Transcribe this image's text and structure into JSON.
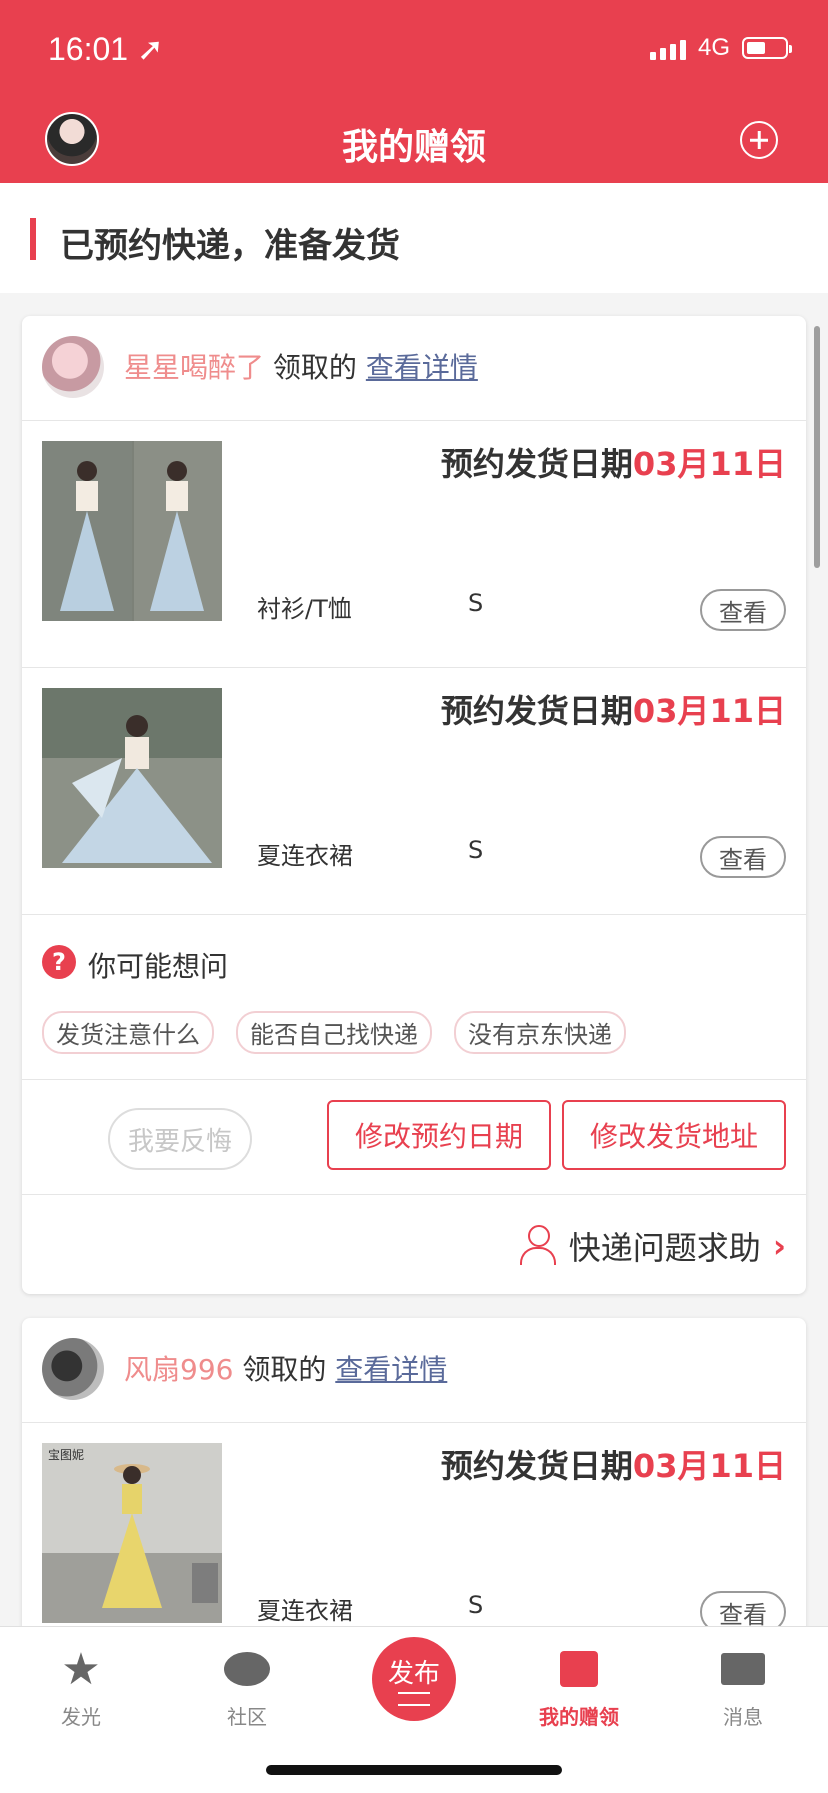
{
  "status": {
    "time": "16:01",
    "network": "4G"
  },
  "nav": {
    "title": "我的赠领"
  },
  "section": {
    "title": "已预约快递，准备发货"
  },
  "cards": [
    {
      "user": "星星喝醉了",
      "claimed": "领取的",
      "detail_link": "查看详情",
      "items": [
        {
          "ship_label": "预约发货日期",
          "ship_date": "03月11日",
          "category": "衬衫/T恤",
          "size": "S",
          "view": "查看"
        },
        {
          "ship_label": "预约发货日期",
          "ship_date": "03月11日",
          "category": "夏连衣裙",
          "size": "S",
          "view": "查看"
        }
      ],
      "faq": {
        "title": "你可能想问",
        "tags": [
          "发货注意什么",
          "能否自己找快递",
          "没有京东快递"
        ]
      },
      "actions": {
        "regret": "我要反悔",
        "change_date": "修改预约日期",
        "change_address": "修改发货地址"
      },
      "help": "快递问题求助"
    },
    {
      "user": "风扇996",
      "claimed": "领取的",
      "detail_link": "查看详情",
      "items": [
        {
          "ship_label": "预约发货日期",
          "ship_date": "03月11日",
          "category": "夏连衣裙",
          "size": "S",
          "view": "查看"
        }
      ]
    }
  ],
  "thumb_text": "宝图妮",
  "tabs": [
    "发光",
    "社区",
    "发布",
    "我的赠领",
    "消息"
  ],
  "colors": {
    "accent": "#e8404f"
  }
}
